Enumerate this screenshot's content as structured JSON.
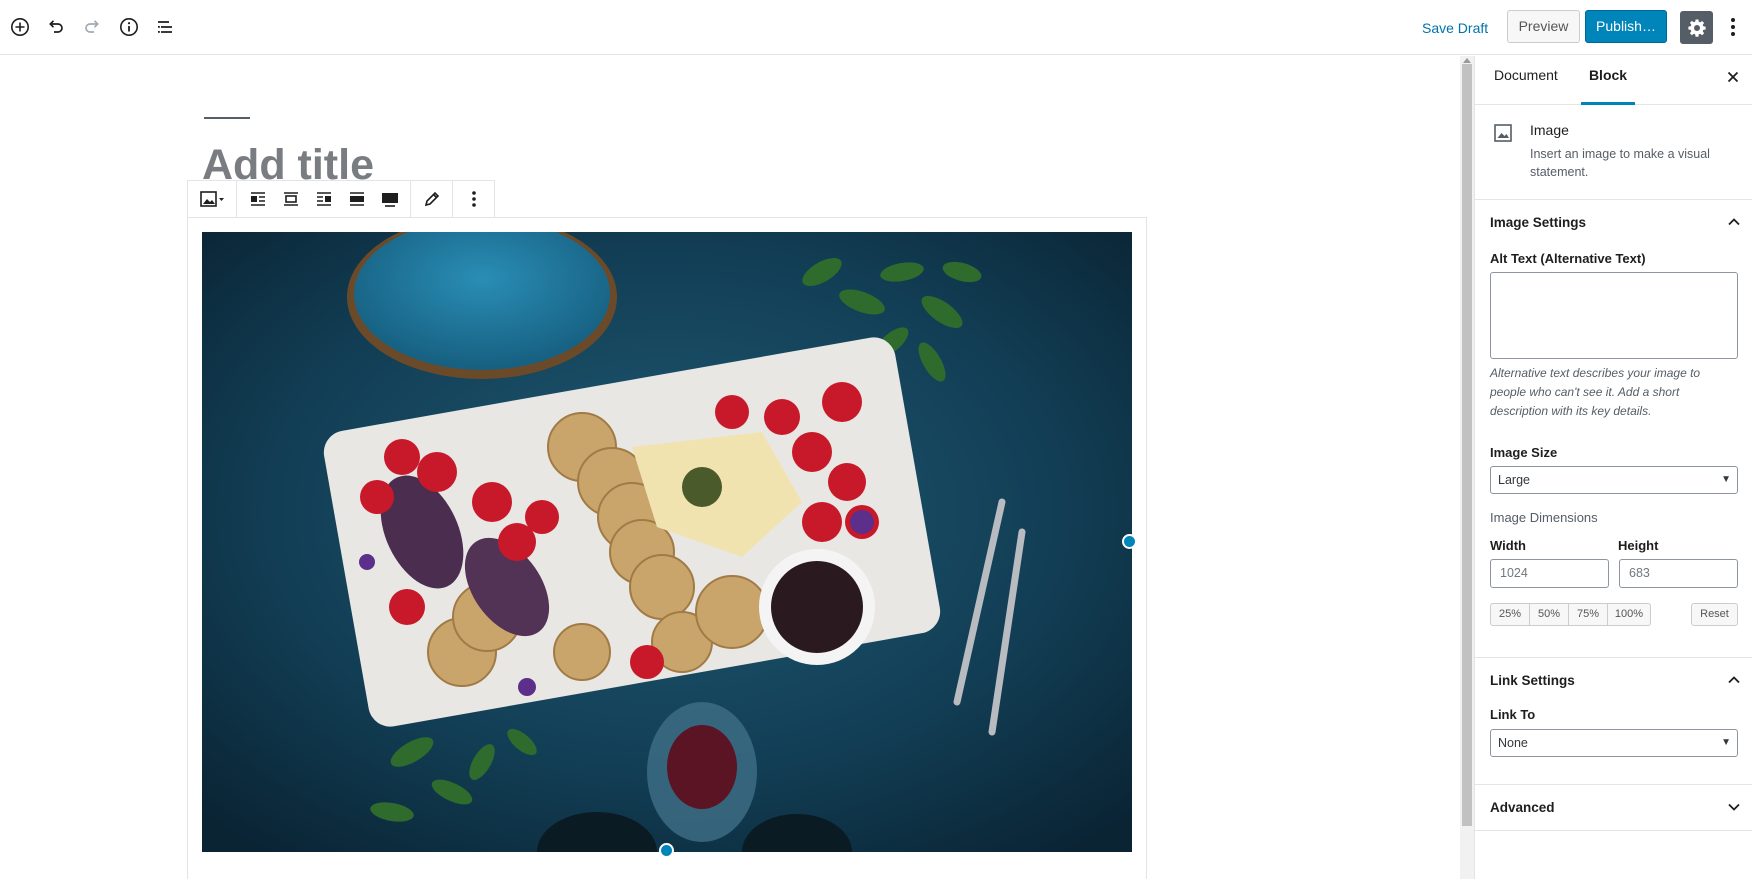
{
  "topbar": {
    "icons": [
      "add-block-icon",
      "undo-icon",
      "redo-icon",
      "info-icon",
      "block-navigation-icon"
    ],
    "save_draft": "Save Draft",
    "preview": "Preview",
    "publish": "Publish…"
  },
  "editor": {
    "title_placeholder": "Add title",
    "block_toolbar": {
      "groups": [
        [
          "image-block-icon"
        ],
        [
          "align-left-icon",
          "align-center-icon",
          "align-right-icon",
          "align-wide-icon",
          "align-full-icon"
        ],
        [
          "edit-pencil-icon"
        ],
        [
          "more-options-icon"
        ]
      ]
    },
    "image": {
      "description": "food platter"
    }
  },
  "sidebar": {
    "tabs": [
      "Document",
      "Block"
    ],
    "active_tab": "Block",
    "block_card": {
      "title": "Image",
      "description": "Insert an image to make a visual statement."
    },
    "image_settings": {
      "title": "Image Settings",
      "alt_label": "Alt Text (Alternative Text)",
      "alt_value": "",
      "alt_help": "Alternative text describes your image to people who can't see it. Add a short description with its key details.",
      "size_label": "Image Size",
      "size_value": "Large",
      "dimensions_label": "Image Dimensions",
      "width_label": "Width",
      "height_label": "Height",
      "width_placeholder": "1024",
      "height_placeholder": "683",
      "percent_buttons": [
        "25%",
        "50%",
        "75%",
        "100%"
      ],
      "reset": "Reset"
    },
    "link_settings": {
      "title": "Link Settings",
      "link_to_label": "Link To",
      "link_to_value": "None"
    },
    "advanced": {
      "title": "Advanced"
    }
  },
  "colors": {
    "accent": "#0085ba",
    "link": "#0073aa",
    "dark": "#555d66"
  }
}
